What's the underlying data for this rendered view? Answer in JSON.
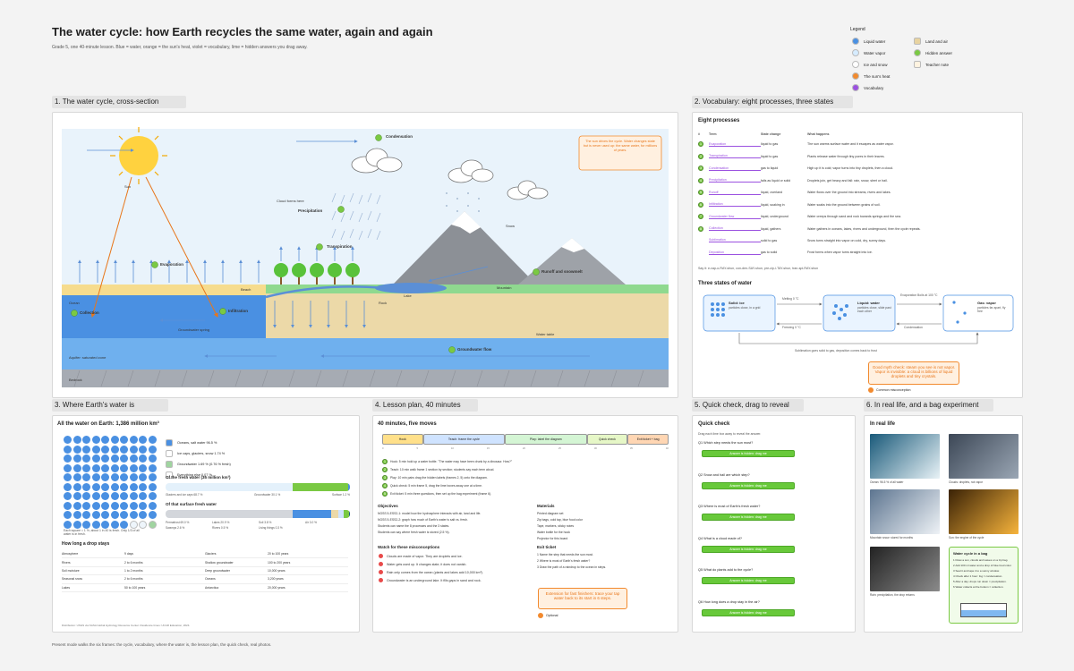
{
  "header": {
    "title": "The water cycle: how Earth recycles the same water, again and again",
    "subtitle": "Grade 5, one 40-minute lesson. Blue = water, orange = the sun's heat, violet = vocabulary, lime = hidden answers you drag away."
  },
  "legend": {
    "title": "Legend",
    "items": [
      {
        "label": "Liquid water",
        "color": "#4a90e2",
        "shape": "dot"
      },
      {
        "label": "Water vapor",
        "color": "#d6ecff",
        "shape": "dot"
      },
      {
        "label": "Ice and snow",
        "color": "#ffffff",
        "shape": "dot"
      },
      {
        "label": "The sun's heat",
        "color": "#f28a2e",
        "shape": "dot"
      },
      {
        "label": "Vocabulary",
        "color": "#9b51e0",
        "shape": "dot"
      },
      {
        "label": "Land and air",
        "color": "#e8d3a0",
        "shape": "sq"
      },
      {
        "label": "Hidden answer",
        "color": "#7ac943",
        "shape": "dot"
      },
      {
        "label": "Teacher note",
        "color": "#fff3e0",
        "shape": "sq"
      }
    ]
  },
  "frames": {
    "f1": "1. The water cycle, cross-section",
    "f2": "2. Vocabulary: eight processes, three states",
    "f3": "3. Where Earth's water is",
    "f4": "4. Lesson plan, 40 minutes",
    "f5": "5. Quick check, drag to reveal",
    "f6": "6. In real life, and a bag experiment"
  },
  "cycle": {
    "labels": {
      "condensation": "Condensation",
      "precipitation": "Precipitation",
      "transpiration": "Transpiration",
      "evaporation": "Evaporation",
      "runoff": "Runoff and snowmelt",
      "infiltration": "Infiltration",
      "collection": "Collection",
      "groundwater": "Groundwater flow",
      "ocean": "Ocean",
      "lake": "Lake",
      "mountain": "Mountain",
      "beach": "Beach",
      "bedrock": "Bedrock",
      "aquifer": "Aquifer: saturated zone",
      "water_table": "Water table",
      "cloud_forms": "Cloud forms here",
      "snow": "Snow",
      "rock": "Rock",
      "sun": "Sun",
      "spring": "Groundwater spring"
    },
    "note": "The sun drives the cycle. Water changes state but is never used up: the same water, for millions of years."
  },
  "vocab": {
    "heading": "Eight processes",
    "cols": [
      "#",
      "Term",
      "State change",
      "What happens"
    ],
    "rows": [
      {
        "term": "Evaporation",
        "change": "liquid to gas",
        "what": "The sun warms surface water and it escapes as water vapor."
      },
      {
        "term": "Transpiration",
        "change": "liquid to gas",
        "what": "Plants release water through tiny pores in their leaves."
      },
      {
        "term": "Condensation",
        "change": "gas to liquid",
        "what": "High up it is cold; vapor turns into tiny droplets, then a cloud."
      },
      {
        "term": "Precipitation",
        "change": "falls as liquid or solid",
        "what": "Droplets join, get heavy and fall: rain, snow, sleet or hail."
      },
      {
        "term": "Runoff",
        "change": "liquid, overland",
        "what": "Water flows over the ground into streams, rivers and lakes."
      },
      {
        "term": "Infiltration",
        "change": "liquid, soaking in",
        "what": "Water soaks into the ground between grains of soil."
      },
      {
        "term": "Groundwater flow",
        "change": "liquid, underground",
        "what": "Water creeps through sand and rock towards springs and the sea."
      },
      {
        "term": "Collection",
        "change": "liquid, gathers",
        "what": "Water gathers in oceans, lakes, rivers and underground, then the cycle repeats."
      },
      {
        "term": "Sublimation",
        "change": "solid to gas",
        "what": "Snow turns straight into vapor on cold, dry, sunny days."
      },
      {
        "term": "Deposition",
        "change": "gas to solid",
        "what": "Frost forms when vapor turns straight into ice."
      }
    ],
    "footnote": "Say it: e-vap-o-RAY-shun, con-den-SAY-shun, pre-cip-i-TAY-shun, tran-spi-RAY-shun",
    "states_heading": "Three states of water",
    "solid": {
      "title": "Solid: ice",
      "desc": "particles close, in a grid"
    },
    "liquid": {
      "title": "Liquid: water",
      "desc": "particles close, slide past each other"
    },
    "gas": {
      "title": "Gas: vapor",
      "desc": "particles far apart, fly free"
    },
    "arrows": {
      "melt": "Melting 0 °C",
      "freeze": "Freezing 0 °C",
      "evap": "Evaporation Boils at 100 °C",
      "cond": "Condensation",
      "sub": "Sublimation goes solid to gas, deposition comes back to frost"
    },
    "sticky": "Good myth check: steam you see is not vapor. Vapor is invisible: a cloud is billions of liquid droplets and tiny crystals.",
    "sticky_tag": "Common misconception"
  },
  "dist": {
    "heading": "All the water on Earth: 1,386 million km³",
    "bullets": [
      {
        "label": "Oceans, salt water 96.5 %",
        "color": "#4a90e2"
      },
      {
        "label": "Ice caps, glaciers, snow 1.74 %",
        "color": "#ffffff"
      },
      {
        "label": "Groundwater 1.69 % (0.76 % fresh)",
        "color": "#a0d4a0"
      },
      {
        "label": "Everything else 0.07 %",
        "color": "#ffffff"
      }
    ],
    "fresh_heading": "Of the fresh water (35 million km³)",
    "fresh_parts": [
      "Glaciers and ice caps 68.7 %",
      "Groundwater 30.1 %",
      "Surface 1.2 %"
    ],
    "surface_heading": "Of that surface fresh water",
    "surface_parts": [
      "Permafrost 69.0 %",
      "Lakes 20.9 %",
      "Soil 3.8 %",
      "Air 3.0 %",
      "Swamps 2.6 %",
      "Rivers 0.5 %",
      "Living things 0.3 %"
    ],
    "grid_caption": "Each square = 1 %; about 1 in 40 is fresh. Only 1/3 of all water is in fresh.",
    "stay_heading": "How long a drop stays",
    "stay": [
      [
        "Atmosphere",
        "9 days",
        "Glaciers",
        "20 to 100 years"
      ],
      [
        "Rivers",
        "2 to 6 months",
        "Shallow groundwater",
        "100 to 200 years"
      ],
      [
        "Soil moisture",
        "1 to 2 months",
        "Deep groundwater",
        "10,000 years"
      ],
      [
        "Seasonal snow",
        "2 to 6 months",
        "Oceans",
        "3,200 years"
      ],
      [
        "Lakes",
        "50 to 100 years",
        "Antarctica",
        "20,000 years"
      ]
    ],
    "source": "Distribution: USGS via NASA Global Hydrology Resource Center. Residence times: UCAR Education, 2024."
  },
  "plan": {
    "heading": "40 minutes, five moves",
    "segments": [
      "Hook",
      "Teach: frame the cycle",
      "Play: label the diagram",
      "Quick check",
      "Exit ticket + bag"
    ],
    "seg_colors": [
      "#ffe08a",
      "#cfe3ff",
      "#d4f5d4",
      "#e6f7c7",
      "#ffd6b3"
    ],
    "steps": [
      "Hook: 5 min hold up a water bottle. \"The water may have been drunk by a dinosaur. How?\"",
      "Teach: 10 min walk frame 1 section by section; students say each term aloud.",
      "Play: 10 min pairs drag the hidden labels (frames 2, 5) onto the diagram.",
      "Quick check: 5 min frame 5, drag the lime boxes away one at a time.",
      "Exit ticket: 5 min three questions, then set up the bag experiment (frame 6)."
    ],
    "objectives_heading": "Objectives",
    "objectives": [
      "NGSS 5-ESS2-1: model how the hydrosphere interacts with air, land and life.",
      "NGSS 5-ESS2-2: graph how much of Earth's water is salt vs. fresh.",
      "Students can name the 8 processes and the 3 states.",
      "Students can say where fresh water is stored (2.5 %)."
    ],
    "materials_heading": "Materials",
    "materials": [
      "Printed diagram set",
      "Zip bags, cold tap, blue food color",
      "Tape, markers, sticky notes",
      "Water bottle for the hook",
      "Projector for this board"
    ],
    "mis_heading": "Watch for these misconceptions",
    "misconceptions": [
      "Clouds are made of vapor. They are droplets and ice.",
      "Water gets used up. It changes state; it does not vanish.",
      "Rain only comes from the ocean (plants and lakes add 10,000 km³).",
      "Groundwater is an underground lake. It fills gaps in sand and rock."
    ],
    "exit_heading": "Exit ticket",
    "exit": [
      "1 Name the step that needs the sun most.",
      "2 Where is most of Earth's fresh water?",
      "3 Draw the path of a raindrop to the ocean in steps."
    ],
    "sticky": "Extension for fast finishers: trace your tap water back to its start in 6 steps.",
    "sticky_tag": "Optional"
  },
  "quiz": {
    "heading": "Quick check",
    "intro": "Drag each lime box away to reveal the answer.",
    "items": [
      {
        "q": "Q1 Which step needs the sun most?",
        "a": "Answer is hidden: drag me"
      },
      {
        "q": "Q2 Snow and hail are which step?",
        "a": "Answer is hidden: drag me"
      },
      {
        "q": "Q3 Where is most of Earth's fresh water?",
        "a": "Answer is hidden: drag me"
      },
      {
        "q": "Q4 What is a cloud made of?",
        "a": "Answer is hidden: drag me"
      },
      {
        "q": "Q5 What do plants add to the cycle?",
        "a": "Answer is hidden: drag me"
      },
      {
        "q": "Q6 How long does a drop stay in the air?",
        "a": "Answer is hidden: drag me"
      }
    ]
  },
  "real": {
    "heading": "In real life",
    "photos": [
      {
        "caption": "Ocean: 96.5 % of all water",
        "c1": "#1a5a7a",
        "c2": "#e8f2f6"
      },
      {
        "caption": "Clouds: droplets, not vapor",
        "c1": "#3c4756",
        "c2": "#9aa6b4"
      },
      {
        "caption": "Mountain snow: stored for months",
        "c1": "#5d7590",
        "c2": "#eef2f6"
      },
      {
        "caption": "Sun: the engine of the cycle",
        "c1": "#3a2206",
        "c2": "#f7b43c"
      },
      {
        "caption": "Rain: precipitation, the drop returns",
        "c1": "#222222",
        "c2": "#8a8a8a"
      }
    ],
    "bag_title": "Water cycle in a bag",
    "bag_steps": [
      "1 Draw a sun, clouds and waves on a zip bag.",
      "2 Add 100 ml water and a drop of blue food color.",
      "3 Seal it and tape it to a sunny window.",
      "4 Check after 1 hour: fog = condensation.",
      "5 After a day: drops run down = precipitation.",
      "6 Water collects at the bottom = collection."
    ]
  },
  "footer": "Present mode walks the six frames: the cycle, vocabulary, where the water is, the lesson plan, the quick check, real photos."
}
